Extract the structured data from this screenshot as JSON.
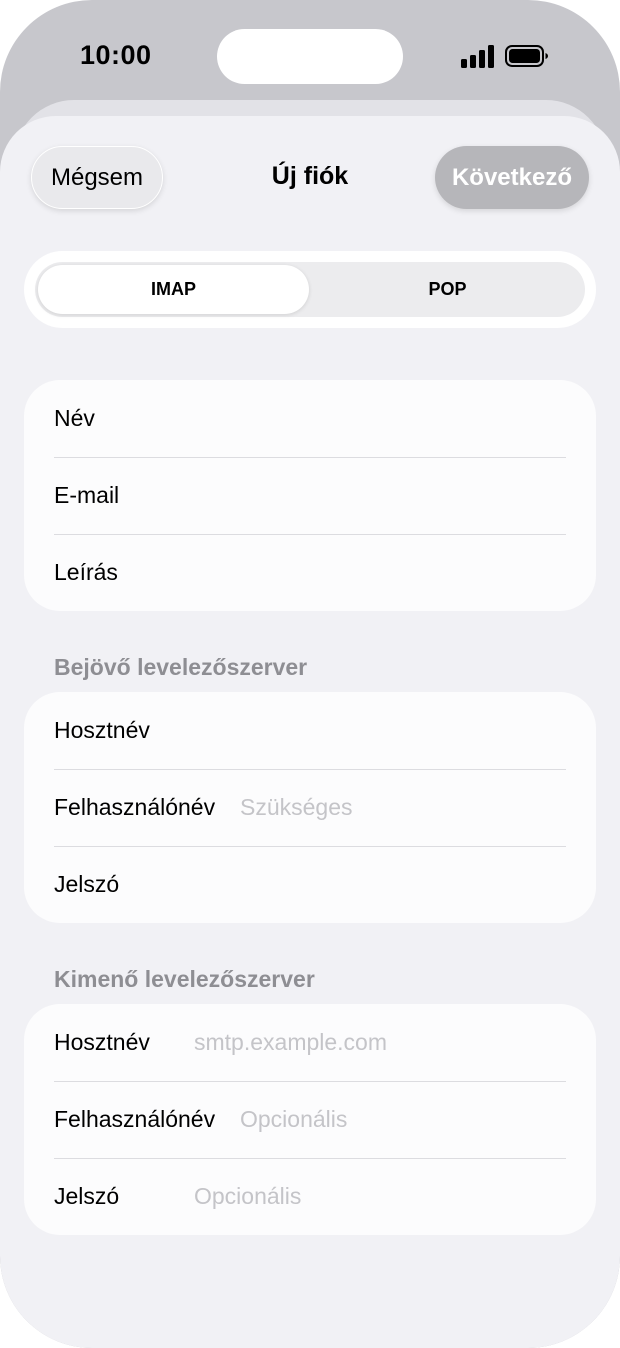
{
  "status_bar": {
    "time": "10:00"
  },
  "nav": {
    "cancel_label": "Mégsem",
    "title": "Új fiók",
    "next_label": "Következő"
  },
  "segment": {
    "options": [
      "IMAP",
      "POP"
    ],
    "selected": "IMAP"
  },
  "account": {
    "rows": [
      {
        "label": "Név",
        "value": "",
        "placeholder": ""
      },
      {
        "label": "E-mail",
        "value": "",
        "placeholder": ""
      },
      {
        "label": "Leírás",
        "value": "",
        "placeholder": ""
      }
    ]
  },
  "incoming": {
    "title": "Bejövő levelezőszerver",
    "rows": [
      {
        "label": "Hosztnév",
        "value": "",
        "placeholder": ""
      },
      {
        "label": "Felhasználónév",
        "value": "",
        "placeholder": "Szükséges"
      },
      {
        "label": "Jelszó",
        "value": "",
        "placeholder": ""
      }
    ]
  },
  "outgoing": {
    "title": "Kimenő levelezőszerver",
    "rows": [
      {
        "label": "Hosztnév",
        "value": "",
        "placeholder": "smtp.example.com"
      },
      {
        "label": "Felhasználónév",
        "value": "",
        "placeholder": "Opcionális"
      },
      {
        "label": "Jelszó",
        "value": "",
        "placeholder": "Opcionális"
      }
    ]
  },
  "colors": {
    "background": "#f1f1f5",
    "card": "#fcfcfd",
    "section_header": "#8e8e93",
    "placeholder": "#c4c4c8",
    "next_button_disabled": "#b6b6ba"
  },
  "icons": [
    "signal-icon",
    "battery-icon"
  ]
}
